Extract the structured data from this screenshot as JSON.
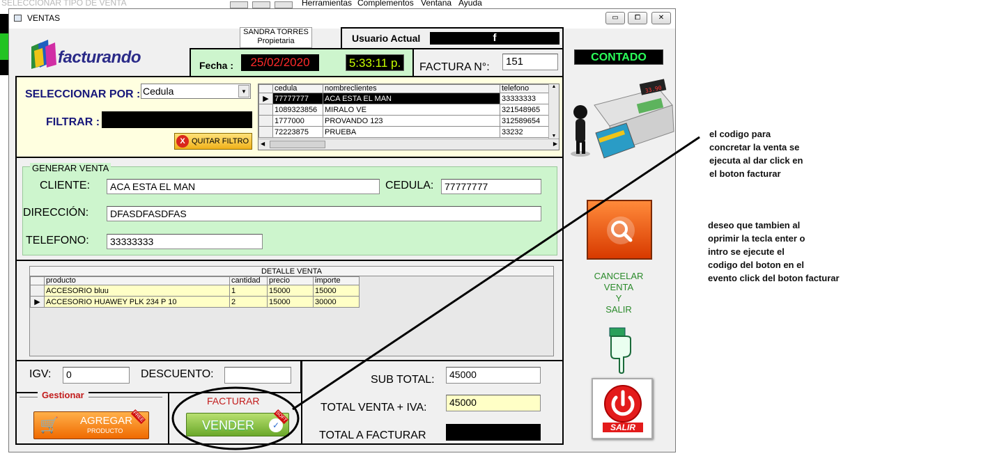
{
  "background_app": {
    "caption": "SELECCIONAR TIPO DE VENTA",
    "menu": [
      "Herramientas",
      "Complementos",
      "Ventana",
      "Ayuda"
    ]
  },
  "window": {
    "title": "VENTAS",
    "buttons": {
      "minimize": "▭",
      "maximize": "⧠",
      "close": "✕"
    }
  },
  "header": {
    "logo_text": "facturando",
    "owner_name": "SANDRA TORRES",
    "owner_role": "Propietaria",
    "current_user_label": "Usuario Actual",
    "current_user_value": "f",
    "date_label": "Fecha :",
    "date_value": "25/02/2020",
    "time_value": "5:33:11 p.",
    "invoice_label": "FACTURA N°:",
    "invoice_value": "151",
    "payment_mode": "CONTADO"
  },
  "filter": {
    "select_by_label": "SELECCIONAR POR :",
    "select_by_value": "Cedula",
    "filter_label": "FILTRAR :",
    "filter_value": "",
    "clear_filter_label": "QUITAR FILTRO"
  },
  "clients_grid": {
    "columns": [
      "cedula",
      "nombreclientes",
      "telefono"
    ],
    "rows": [
      [
        "77777777",
        "ACA ESTA EL MAN",
        "33333333"
      ],
      [
        "1089323856",
        "MIRALO VE",
        "321548965"
      ],
      [
        "1777000",
        "PROVANDO 123",
        "312589654"
      ],
      [
        "72223875",
        "PRUEBA",
        "33232"
      ]
    ]
  },
  "sale": {
    "section_title": "GENERAR VENTA",
    "client_label": "CLIENTE:",
    "client_value": "ACA ESTA EL MAN",
    "id_label": "CEDULA:",
    "id_value": "77777777",
    "address_label": "DIRECCIÓN:",
    "address_value": "DFASDFASDFAS",
    "phone_label": "TELEFONO:",
    "phone_value": "33333333"
  },
  "detail_grid": {
    "caption": "DETALLE VENTA",
    "columns": [
      "producto",
      "cantidad",
      "precio",
      "importe"
    ],
    "rows": [
      [
        "ACCESORIO  bluu",
        "1",
        "15000",
        "15000"
      ],
      [
        "ACCESORIO  HUAWEY  PLK 234 P 10",
        "2",
        "15000",
        "30000"
      ]
    ]
  },
  "totals": {
    "igv_label": "IGV:",
    "igv_value": "0",
    "discount_label": "DESCUENTO:",
    "discount_value": "",
    "subtotal_label": "SUB TOTAL:",
    "subtotal_value": "45000",
    "total_iva_label": "TOTAL VENTA + IVA:",
    "total_iva_value": "45000",
    "total_invoice_label": "TOTAL A FACTURAR",
    "total_invoice_value": ""
  },
  "actions": {
    "manage_label": "Gestionar",
    "add_label": "AGREGAR",
    "add_sub": "PRODUCTO",
    "add_badge": "FREE",
    "invoice_caption": "FACTURAR",
    "sell_label": "VENDER",
    "sell_badge": "SOFT",
    "cancel_lines": [
      "CANCELAR",
      "VENTA",
      "Y",
      "SALIR"
    ],
    "exit_label": "SALIR",
    "register_display": "33.90"
  },
  "annotations": {
    "note1": [
      "el codigo para",
      "concretar la venta se",
      "ejecuta al dar click en",
      "el boton facturar"
    ],
    "note2": [
      "deseo que tambien al",
      "oprimir la tecla enter o",
      "intro se ejecute el",
      "codigo del boton en el",
      "evento click  del boton facturar"
    ]
  },
  "colors": {
    "date_red": "#ff2a2a",
    "time_green": "#c8ff00",
    "payment_green": "#2bff5a",
    "sale_panel_bg": "#cdf5cd",
    "filter_panel_bg": "#ffffe0",
    "highlight_yellow": "#ffffc6",
    "invoice_red": "#c21b1b",
    "cancel_green": "#2a8a2a"
  }
}
